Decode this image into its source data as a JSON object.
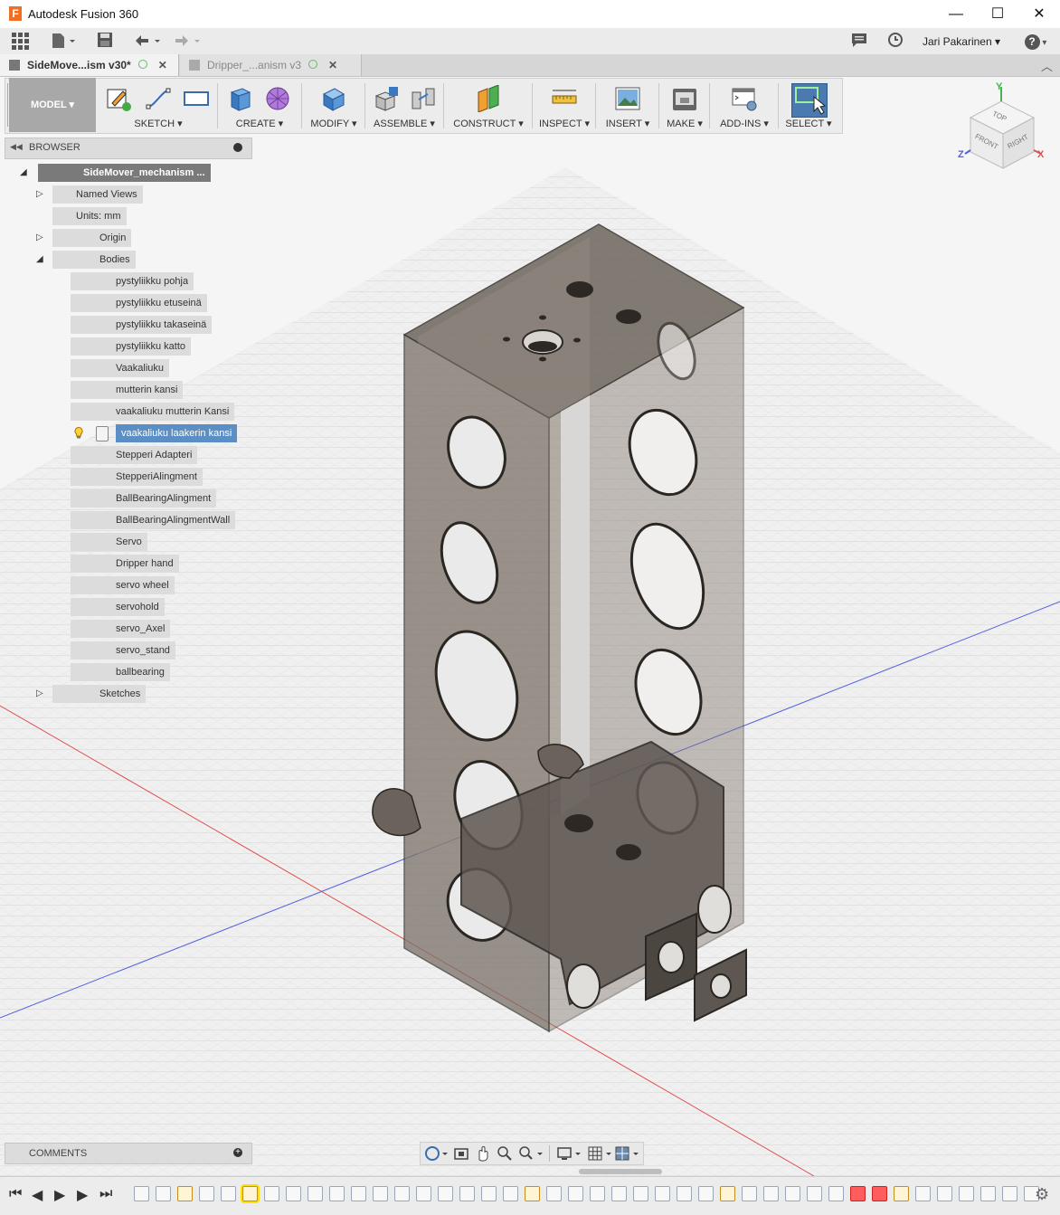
{
  "window": {
    "app_title": "Autodesk Fusion 360",
    "logo_letter": "F",
    "minimize": "—",
    "maximize": "☐",
    "close": "✕"
  },
  "quickbar": {
    "user": "Jari Pakarinen ▾",
    "help": "?"
  },
  "tabs": [
    {
      "label": "SideMove...ism v30*",
      "close": "✕"
    },
    {
      "label": "Dripper_...anism v3",
      "close": "✕"
    }
  ],
  "ribbon": {
    "mode": "MODEL ▾",
    "groups": [
      {
        "label": "SKETCH ▾"
      },
      {
        "label": "CREATE ▾"
      },
      {
        "label": "MODIFY ▾"
      },
      {
        "label": "ASSEMBLE ▾"
      },
      {
        "label": "CONSTRUCT ▾"
      },
      {
        "label": "INSPECT ▾"
      },
      {
        "label": "INSERT ▾"
      },
      {
        "label": "MAKE ▾"
      },
      {
        "label": "ADD-INS ▾"
      },
      {
        "label": "SELECT ▾"
      }
    ]
  },
  "viewcube": {
    "top": "TOP",
    "front": "FRONT",
    "right": "RIGHT",
    "axis_x": "X",
    "axis_y": "Y",
    "axis_z": "Z"
  },
  "browser": {
    "title": "BROWSER",
    "root": "SideMover_mechanism ...",
    "named_views": "Named Views",
    "units": "Units: mm",
    "origin": "Origin",
    "bodies_label": "Bodies",
    "bodies": [
      "pystyliikku pohja",
      "pystyliikku etuseinä",
      "pystyliikku takaseinä",
      "pystyliikku katto",
      "Vaakaliuku",
      "mutterin kansi",
      "vaakaliuku mutterin Kansi",
      "vaakaliuku laakerin kansi",
      "Stepperi Adapteri",
      "StepperiAlingment",
      "BallBearingAlingment",
      "BallBearingAlingmentWall",
      "Servo",
      "Dripper hand",
      "servo wheel",
      "servohold",
      "servo_Axel",
      "servo_stand",
      "ballbearing"
    ],
    "selected_index": 7,
    "lit_count": 9,
    "sketches": "Sketches"
  },
  "comments": {
    "label": "COMMENTS"
  },
  "colors": {
    "selection": "#5a8ec4",
    "grid_axis_x": "#e05050",
    "grid_axis_z": "#5060e0",
    "error_feature": "#ff5d5d",
    "highlight_feature": "#ffe100"
  }
}
